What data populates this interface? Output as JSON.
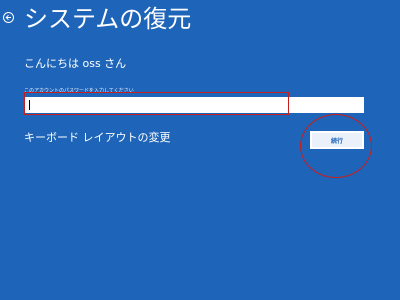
{
  "header": {
    "title": "システムの復元",
    "back_icon": "back-arrow-icon"
  },
  "greeting": "こんにちは oss さん",
  "password": {
    "label": "このアカウントのパスワードを入力してください",
    "value": ""
  },
  "keyboard_layout_link": "キーボード レイアウトの変更",
  "continue_button": "続行",
  "colors": {
    "background": "#1e64b8",
    "text": "#ffffff",
    "button_bg": "#eaf1fb",
    "annotation": "#c81e1e"
  }
}
